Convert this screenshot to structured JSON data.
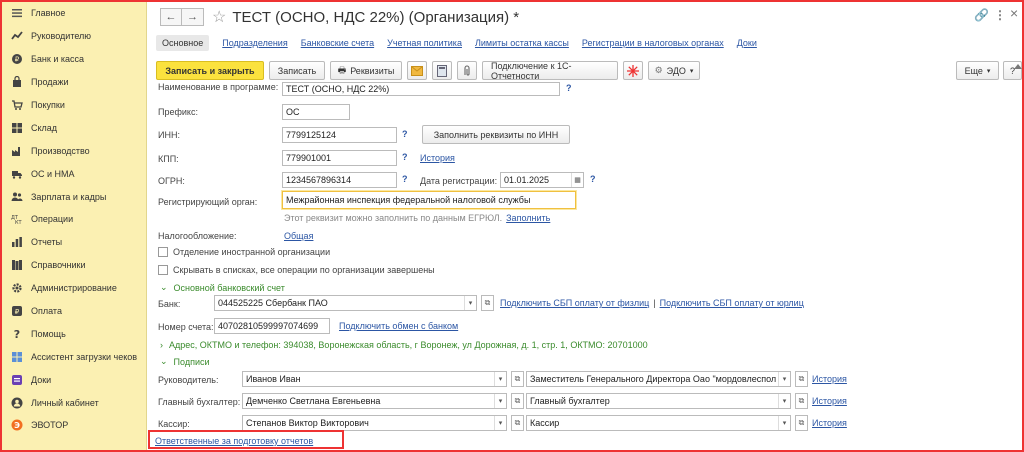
{
  "sidebar": {
    "items": [
      {
        "label": "Главное",
        "icon": "menu-icon"
      },
      {
        "label": "Руководителю",
        "icon": "trend-icon"
      },
      {
        "label": "Банк и касса",
        "icon": "coin-icon"
      },
      {
        "label": "Продажи",
        "icon": "bag-icon"
      },
      {
        "label": "Покупки",
        "icon": "cart-icon"
      },
      {
        "label": "Склад",
        "icon": "warehouse-icon"
      },
      {
        "label": "Производство",
        "icon": "factory-icon"
      },
      {
        "label": "ОС и НМА",
        "icon": "truck-icon"
      },
      {
        "label": "Зарплата и кадры",
        "icon": "people-icon"
      },
      {
        "label": "Операции",
        "icon": "dt-kt-icon"
      },
      {
        "label": "Отчеты",
        "icon": "chart-icon"
      },
      {
        "label": "Справочники",
        "icon": "books-icon"
      },
      {
        "label": "Администрирование",
        "icon": "gear-icon"
      },
      {
        "label": "Оплата",
        "icon": "payment-icon"
      },
      {
        "label": "Помощь",
        "icon": "help-icon"
      },
      {
        "label": "Ассистент загрузки чеков",
        "icon": "grid-icon"
      },
      {
        "label": "Доки",
        "icon": "docs-icon"
      },
      {
        "label": "Личный кабинет",
        "icon": "user-icon"
      },
      {
        "label": "ЭВОТОР",
        "icon": "evotor-icon"
      }
    ]
  },
  "header": {
    "back": "←",
    "forward": "→",
    "star": "☆",
    "title": "ТЕСТ (ОСНО, НДС 22%) (Организация) *",
    "link_icon": "🔗",
    "more_icon": "⋮",
    "close_icon": "×"
  },
  "tabs": [
    {
      "label": "Основное",
      "active": true
    },
    {
      "label": "Подразделения"
    },
    {
      "label": "Банковские счета"
    },
    {
      "label": "Учетная политика"
    },
    {
      "label": "Лимиты остатка кассы"
    },
    {
      "label": "Регистрации в налоговых органах"
    },
    {
      "label": "Доки"
    }
  ],
  "toolbar": {
    "save_close": "Записать и закрыть",
    "save": "Записать",
    "requisites": "Реквизиты",
    "connect": "Подключение к 1С-Отчетности",
    "edo": "ЭДО",
    "more": "Еще",
    "help": "?"
  },
  "form": {
    "name_label": "Наименование в программе:",
    "name_value": "ТЕСТ (ОСНО, НДС 22%)",
    "prefix_label": "Префикс:",
    "prefix_value": "ОС",
    "inn_label": "ИНН:",
    "inn_value": "7799125124",
    "fill_btn": "Заполнить реквизиты по ИНН",
    "kpp_label": "КПП:",
    "kpp_value": "779901001",
    "history": "История",
    "ogrn_label": "ОГРН:",
    "ogrn_value": "1234567896314",
    "reg_date_label": "Дата регистрации:",
    "reg_date_value": "01.01.2025",
    "reg_organ_label": "Регистрирующий орган:",
    "reg_organ_value": "Межрайонная инспекция федеральной налоговой службы",
    "hint_text": "Этот реквизит можно заполнить по данным ЕГРЮЛ.",
    "fill_link": "Заполнить",
    "tax_label": "Налогообложение:",
    "tax_value": "Общая",
    "foreign_cb": "Отделение иностранной организации",
    "hide_cb": "Скрывать в списках, все операции по организации завершены",
    "q": "?"
  },
  "bank": {
    "section": "Основной банковский счет",
    "bank_label": "Банк:",
    "bank_value": "044525225 Сбербанк ПАО",
    "sbp_individual": "Подключить СБП оплату от физлиц",
    "sep": "|",
    "sbp_legal": "Подключить СБП оплату от юрлиц",
    "account_label": "Номер счета:",
    "account_value": "40702810599997074699",
    "exchange_link": "Подключить обмен с банком"
  },
  "address": {
    "text": "Адрес, ОКТМО и телефон: 394038, Воронежская область, г Воронеж, ул Дорожная, д. 1, стр. 1, ОКТМО: 20701000"
  },
  "signatures": {
    "section": "Подписи",
    "rows": [
      {
        "label": "Руководитель:",
        "person": "Иванов  Иван",
        "position": "Заместитель Генерального Директора Оао \"мордовлеспол",
        "history": "История"
      },
      {
        "label": "Главный бухгалтер:",
        "person": "Демченко Светлана Евгеньевна",
        "position": "Главный бухгалтер",
        "history": "История"
      },
      {
        "label": "Кассир:",
        "person": "Степанов Виктор Викторович",
        "position": "Кассир",
        "history": "История"
      }
    ],
    "responsible_link": "Ответственные за подготовку отчетов"
  }
}
